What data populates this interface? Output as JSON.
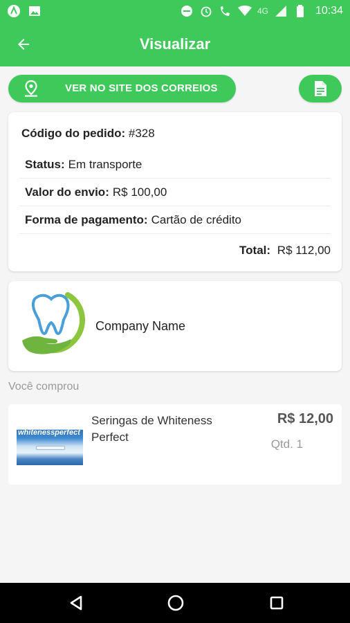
{
  "status_bar": {
    "time": "10:34",
    "network": "4G"
  },
  "app_bar": {
    "title": "Visualizar"
  },
  "actions": {
    "correios_label": "VER NO SITE DOS CORREIOS"
  },
  "order": {
    "code_label": "Código do pedido:",
    "code_value": "#328",
    "status_label": "Status:",
    "status_value": "Em transporte",
    "shipping_label": "Valor do envio:",
    "shipping_value": "R$ 100,00",
    "payment_label": "Forma de pagamento:",
    "payment_value": "Cartão de crédito",
    "total_label": "Total:",
    "total_value": "R$ 112,00"
  },
  "company": {
    "name": "Company Name"
  },
  "purchases": {
    "section_label": "Você comprou",
    "items": [
      {
        "name": "Seringas de Whiteness Perfect",
        "price": "R$ 12,00",
        "qty": "Qtd. 1",
        "image_text": "whitenessperfect"
      }
    ]
  },
  "colors": {
    "primary": "#3ec95a",
    "background": "#f5f5f5"
  }
}
